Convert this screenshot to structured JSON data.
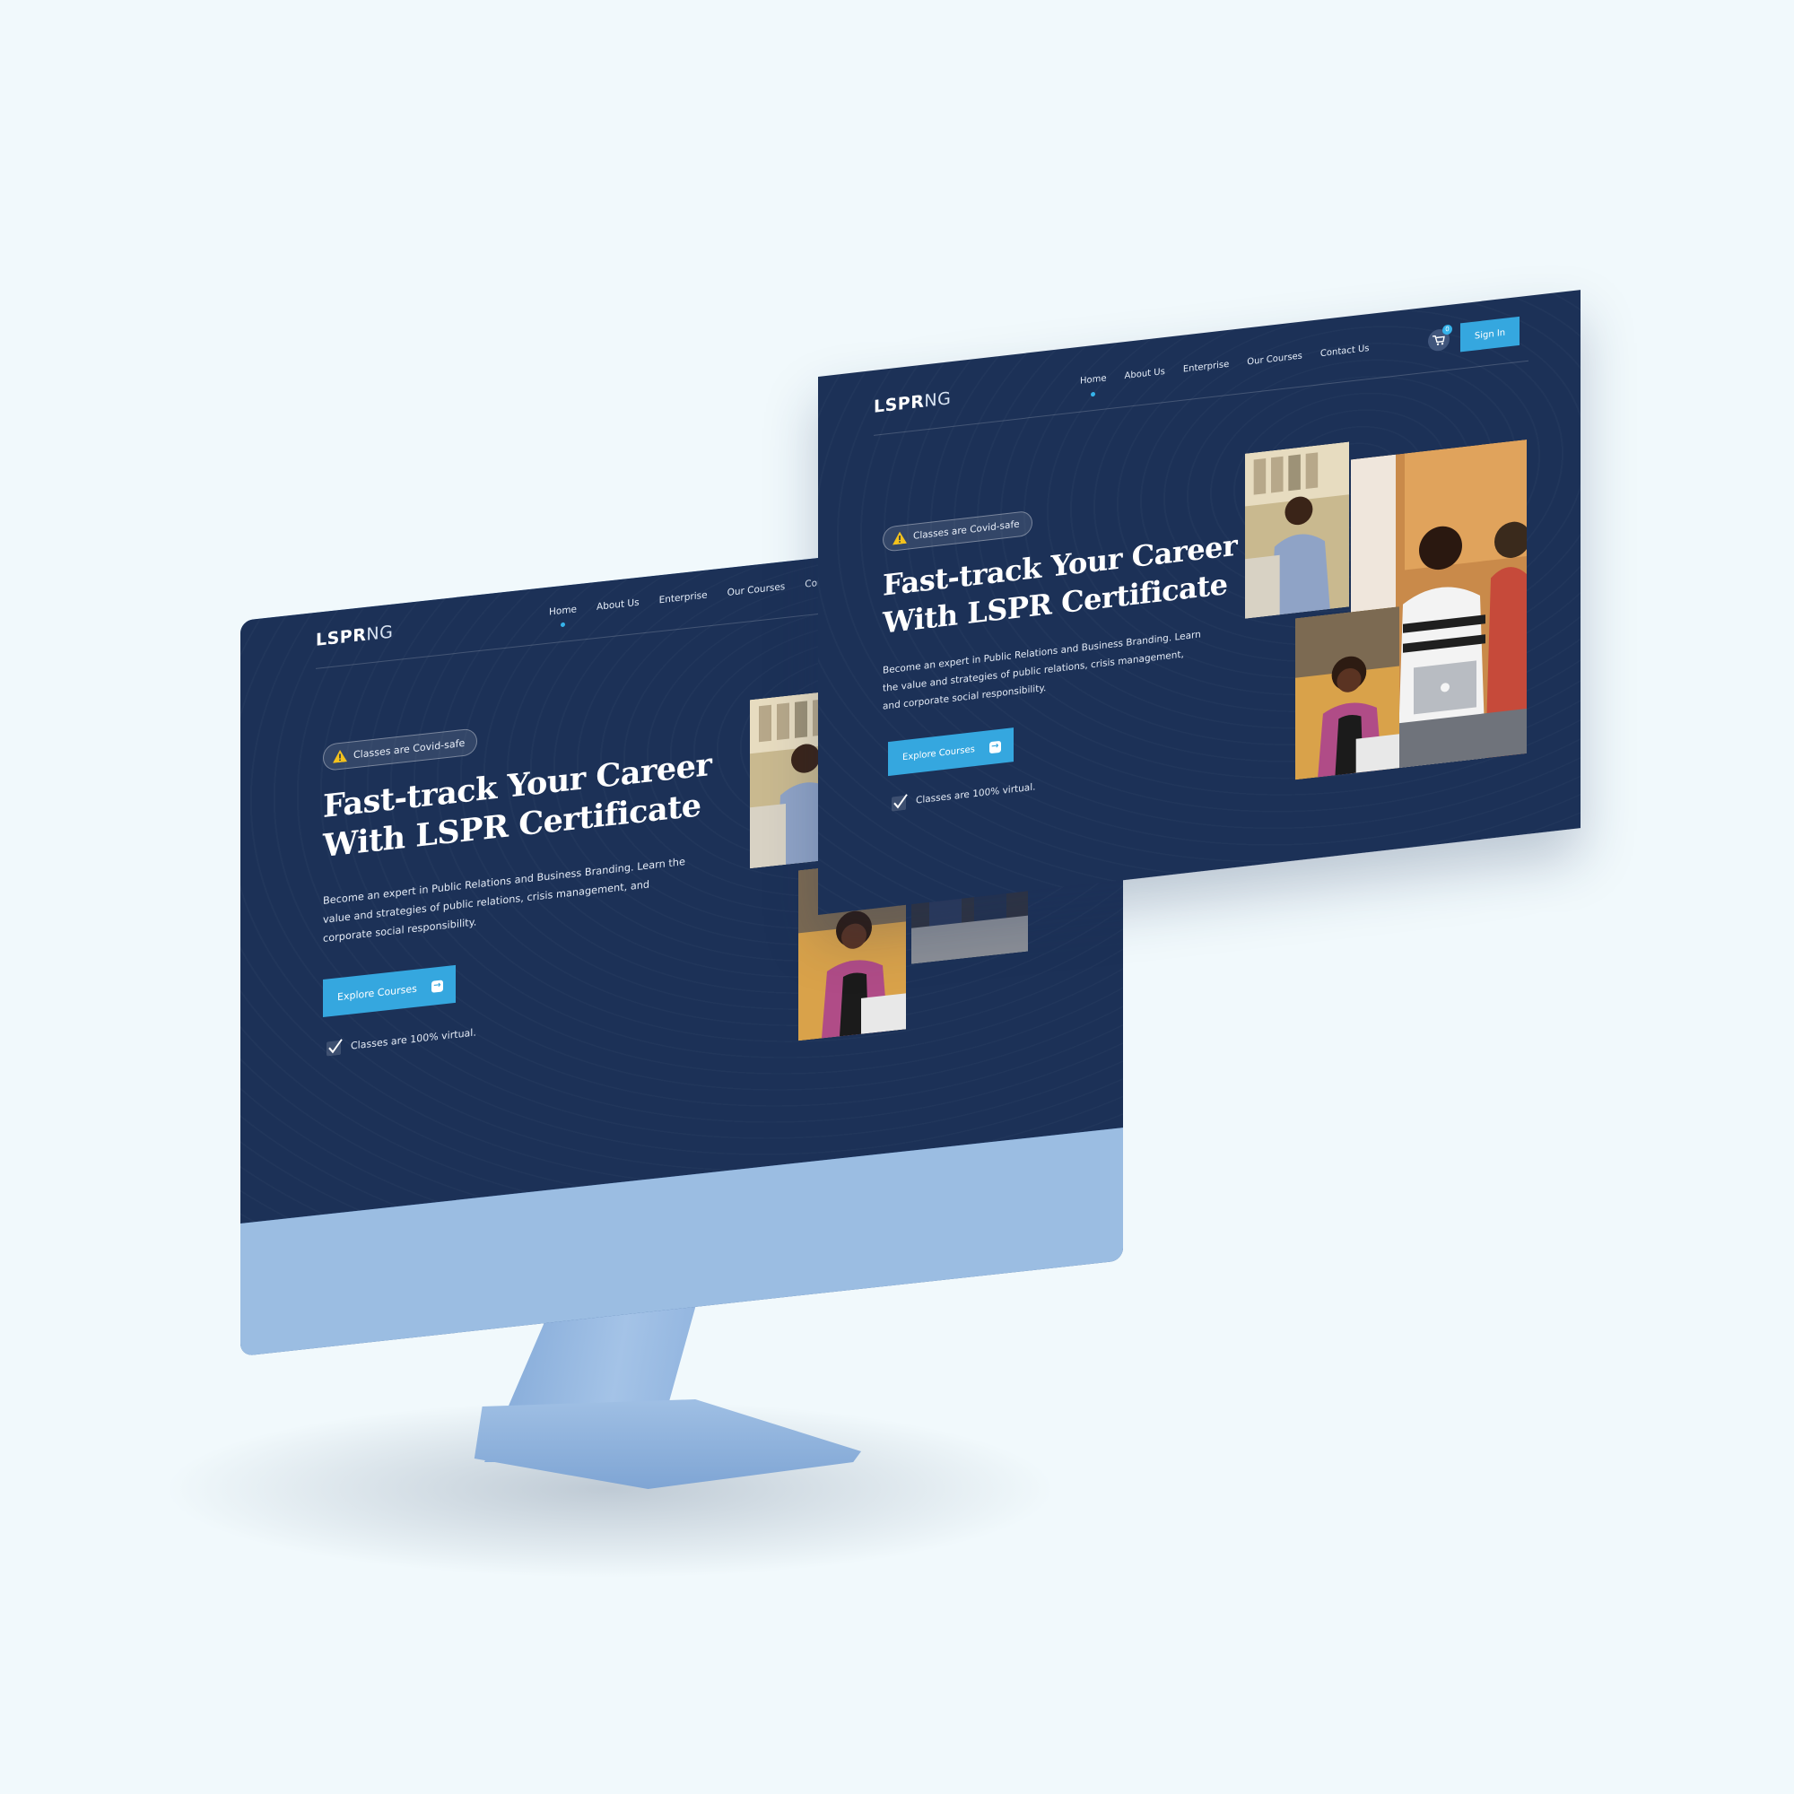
{
  "site": {
    "logo_bold": "LSPR",
    "logo_light": "NG",
    "nav": [
      "Home",
      "About Us",
      "Enterprise",
      "Our Courses",
      "Contact Us"
    ],
    "cart_count": "0",
    "sign_in": "Sign In",
    "badge": "Classes are Covid-safe",
    "headline_line1": "Fast-track Your Career",
    "headline_line2": "With LSPR Certificate",
    "description": "Become an expert in Public Relations and Business Branding. Learn the value and strategies of public relations, crisis management, and corporate social responsibility.",
    "cta": "Explore Courses",
    "virtual_note": "Classes are 100% virtual."
  },
  "icons": {
    "warning": "warning-triangle-icon",
    "arrow": "arrow-right-icon",
    "check": "checkmark-icon",
    "cart": "shopping-cart-icon"
  },
  "colors": {
    "page_background": "#f1f9fc",
    "site_background": "#1c3157",
    "accent": "#35a7df",
    "warning": "#f4c21d",
    "monitor_chin": "#9bbde2",
    "monitor_frame": "#2f5890"
  }
}
